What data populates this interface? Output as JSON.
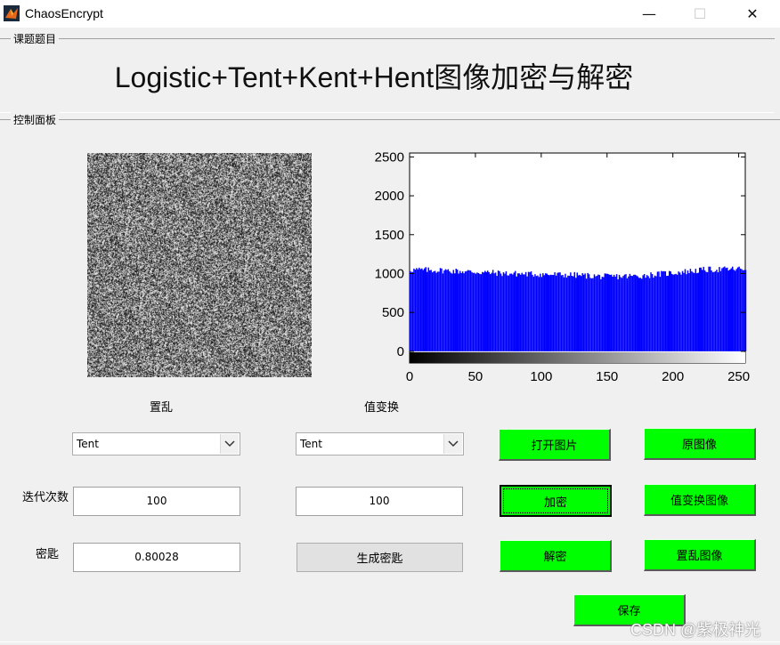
{
  "window": {
    "title": "ChaosEncrypt",
    "minimize": "—",
    "maximize": "☐",
    "close": "✕"
  },
  "topic_panel": {
    "label": "课题题目",
    "title": "Logistic+Tent+Kent+Hent图像加密与解密"
  },
  "control_panel": {
    "label": "控制面板"
  },
  "image_caption": "置乱",
  "histogram_caption": "值变换",
  "left_select": {
    "value": "Tent"
  },
  "right_select": {
    "value": "Tent"
  },
  "iterations": {
    "label": "迭代次数",
    "left_value": "100",
    "right_value": "100"
  },
  "key": {
    "label": "密匙",
    "value": "0.80028"
  },
  "buttons": {
    "generate_key": "生成密匙",
    "open_image": "打开图片",
    "original_image": "原图像",
    "encrypt": "加密",
    "value_transform_image": "值变换图像",
    "decrypt": "解密",
    "scramble_image": "置乱图像",
    "save": "保存"
  },
  "colors": {
    "button_green": "#00ff00",
    "histogram_bar": "#0000ff"
  },
  "chart_data": {
    "type": "bar",
    "title": "",
    "xlabel": "",
    "ylabel": "",
    "xlim": [
      0,
      255
    ],
    "ylim": [
      -150,
      2550
    ],
    "x_ticks": [
      0,
      50,
      100,
      150,
      200,
      250
    ],
    "y_ticks": [
      0,
      500,
      1000,
      1500,
      2000,
      2500
    ],
    "bins": 256,
    "approx_counts": {
      "x": [
        0,
        25,
        50,
        75,
        100,
        125,
        150,
        175,
        200,
        225,
        255
      ],
      "y": [
        1050,
        1040,
        1020,
        1000,
        990,
        980,
        960,
        970,
        1010,
        1050,
        1060
      ]
    },
    "colorbar": "grayscale 0-255"
  },
  "watermark": "CSDN @紫极神光"
}
